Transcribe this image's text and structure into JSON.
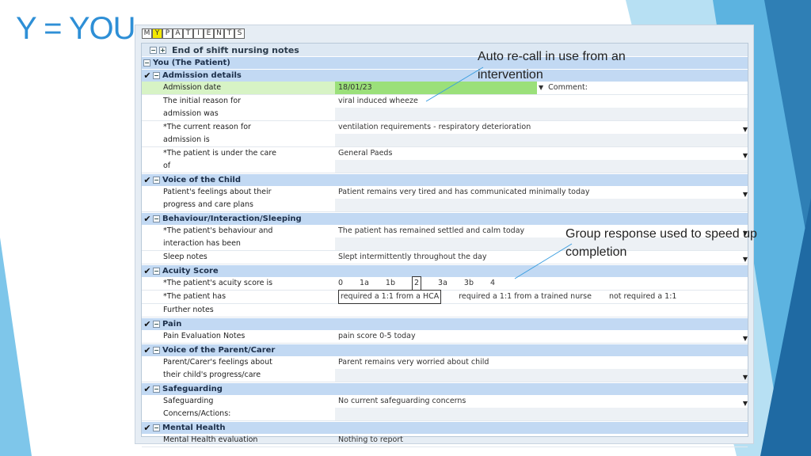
{
  "slide_title": "Y = YOU",
  "tabs": [
    "M",
    "Y",
    "P",
    "A",
    "T",
    "I",
    "E",
    "N",
    "T",
    "S"
  ],
  "active_tab": 1,
  "form_title": "End of shift nursing notes",
  "patient_label": "You (The Patient)",
  "annotations": {
    "auto_recall": "Auto re-call in use from an intervention",
    "group_response": "Group response used to speed up completion"
  },
  "sections": {
    "admission": "Admission details",
    "voice": "Voice of the Child",
    "behaviour": "Behaviour/Interaction/Sleeping",
    "acuity": "Acuity Score",
    "pain": "Pain",
    "parent": "Voice of the Parent/Carer",
    "safeguarding": "Safeguarding",
    "mental": "Mental Health"
  },
  "fields": {
    "admission_date": {
      "label": "Admission date",
      "value": "18/01/23",
      "comment": "Comment:"
    },
    "initial_reason": {
      "label1": "The initial reason for",
      "label2": "admission was",
      "value": "viral induced wheeze"
    },
    "current_reason": {
      "label1": "*The current reason for",
      "label2": "admission is",
      "value": "ventilation requirements - respiratory deterioration"
    },
    "under_care": {
      "label1": "*The patient is under the care",
      "label2": "of",
      "value": "General Paeds"
    },
    "feelings": {
      "label1": "Patient's feelings about their",
      "label2": "progress and care plans",
      "value": "Patient remains very tired and has communicated minimally today"
    },
    "behaviour": {
      "label1": "*The patient's behaviour and",
      "label2": "interaction has been",
      "value": "The patient has remained settled and calm today"
    },
    "sleep": {
      "label": "Sleep notes",
      "value": "Slept intermittently throughout the day"
    },
    "acuity_score": {
      "label": "*The patient's acuity score is",
      "options": [
        "0",
        "1a",
        "1b",
        "2",
        "3a",
        "3b",
        "4"
      ],
      "selected": "2"
    },
    "patient_has": {
      "label": "*The patient has",
      "options": [
        "required a 1:1 from a HCA",
        "required a 1:1 from a trained nurse",
        "not required a 1:1"
      ],
      "selected": "required a 1:1 from a HCA"
    },
    "further_notes": {
      "label": "Further notes",
      "value": ""
    },
    "pain_notes": {
      "label": "Pain Evaluation Notes",
      "value": "pain score 0-5 today"
    },
    "parent_feelings": {
      "label1": "Parent/Carer's feelings about",
      "label2": "their child's progress/care",
      "value": "Parent remains very worried about child"
    },
    "safeguarding": {
      "label1": "Safeguarding",
      "label2": "Concerns/Actions:",
      "value": "No current safeguarding concerns"
    },
    "mental_health": {
      "label": "Mental Health evaluation",
      "value": "Nothing to report"
    }
  },
  "colors": {
    "accent": "#2e8fd6",
    "section": "#c2d9f3",
    "highlight": "#d7f3c5",
    "active_tab": "#f4e800"
  }
}
